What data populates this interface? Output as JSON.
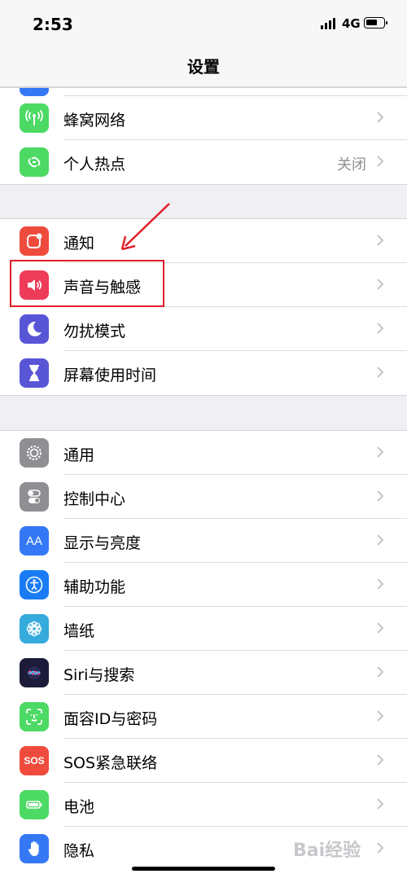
{
  "status_bar": {
    "time": "2:53",
    "network": "4G"
  },
  "nav": {
    "title": "设置"
  },
  "group1": [
    {
      "label": "蜂窝网络",
      "icon": "cellular-icon",
      "color": "#4cd964"
    },
    {
      "label": "个人热点",
      "icon": "hotspot-icon",
      "color": "#4cd964",
      "value": "关闭"
    }
  ],
  "group2": [
    {
      "label": "通知",
      "icon": "notification-icon",
      "color": "#ef4b3d"
    },
    {
      "label": "声音与触感",
      "icon": "sound-icon",
      "color": "#ee3b57"
    },
    {
      "label": "勿扰模式",
      "icon": "moon-icon",
      "color": "#5856d6"
    },
    {
      "label": "屏幕使用时间",
      "icon": "hourglass-icon",
      "color": "#5856d6"
    }
  ],
  "group3": [
    {
      "label": "通用",
      "icon": "gear-icon",
      "color": "#8e8e93"
    },
    {
      "label": "控制中心",
      "icon": "toggles-icon",
      "color": "#8e8e93"
    },
    {
      "label": "显示与亮度",
      "icon": "display-icon",
      "color": "#3478f6"
    },
    {
      "label": "辅助功能",
      "icon": "accessibility-icon",
      "color": "#1a7cf5"
    },
    {
      "label": "墙纸",
      "icon": "wallpaper-icon",
      "color": "#35aadc"
    },
    {
      "label": "Siri与搜索",
      "icon": "siri-icon",
      "color": "#1c1c3a"
    },
    {
      "label": "面容ID与密码",
      "icon": "faceid-icon",
      "color": "#4cd964"
    },
    {
      "label": "SOS紧急联络",
      "icon": "sos-icon",
      "color": "#ef4b3d",
      "icon_text": "SOS"
    },
    {
      "label": "电池",
      "icon": "battery-icon",
      "color": "#4cd964"
    },
    {
      "label": "隐私",
      "icon": "hand-icon",
      "color": "#3478f6"
    }
  ],
  "icons": {
    "display_text": "AA"
  },
  "watermark": "Bai经验"
}
